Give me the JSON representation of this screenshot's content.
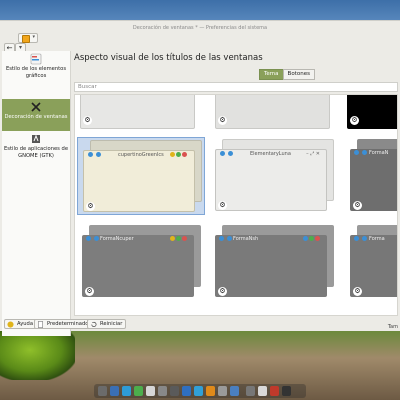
{
  "window": {
    "title": "Decoración de ventanas * — Preferencias del sistema"
  },
  "sidebar": {
    "items": [
      {
        "label": "Estilo de los elementos gráficos",
        "active": false
      },
      {
        "label": "Decoración de ventanas",
        "active": true
      },
      {
        "label": "Estilo de aplicaciones de GNOME (GTK)",
        "active": false
      }
    ]
  },
  "main": {
    "heading": "Aspecto visual de los títulos de las ventanas",
    "tabs": [
      {
        "label": "Tema",
        "active": true
      },
      {
        "label": "Botones",
        "active": false
      }
    ],
    "search": {
      "placeholder": "Buscar"
    },
    "themes": [
      {
        "name": ""
      },
      {
        "name": ""
      },
      {
        "name": ""
      },
      {
        "name": "cupertinoGreenIcs"
      },
      {
        "name": "ElementaryLuna"
      },
      {
        "name": "FormaN"
      },
      {
        "name": "FormaNcuper"
      },
      {
        "name": "FormaNsh"
      },
      {
        "name": "Forma"
      }
    ],
    "status_text": "Tam"
  },
  "footer": {
    "help_label": "Ayuda",
    "defaults_label": "Predeterminados",
    "reset_label": "Reiniciar"
  },
  "colors": {
    "accent": "#8aa05a",
    "highlight_blue": "#3b8fd6"
  }
}
